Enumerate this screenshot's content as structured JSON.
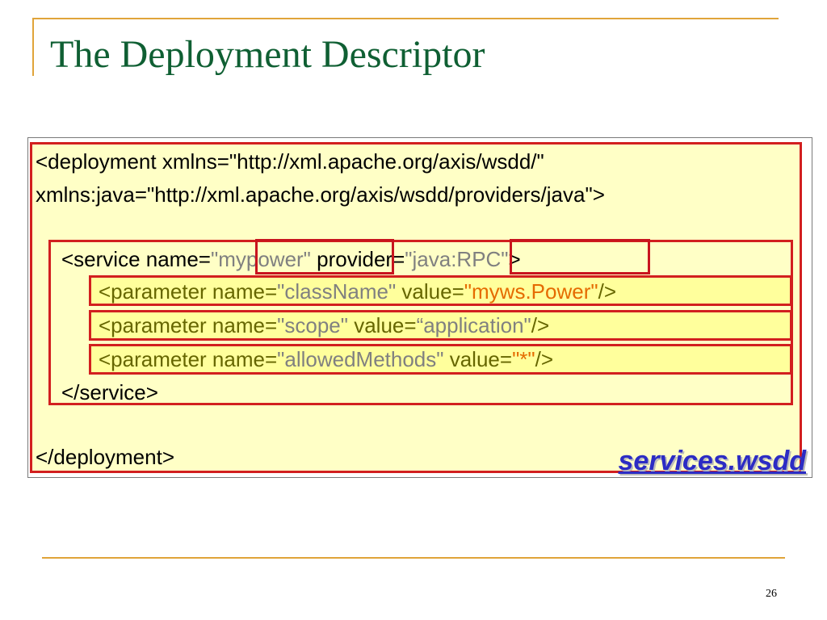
{
  "slide": {
    "title": "The Deployment Descriptor",
    "page_number": "26",
    "file_label": "services.wsdd"
  },
  "code": {
    "deploy_open_1": "<deployment xmlns=\"http://xml.apache.org/axis/wsdd/\"",
    "deploy_open_2": "xmlns:java=\"http://xml.apache.org/axis/wsdd/providers/java\">",
    "service": {
      "tag_start": "<service name=",
      "name_value": "\"mypower\"",
      "provider_attr": " provider=",
      "provider_value": "\"java:RPC\"",
      "tag_end": ">"
    },
    "params": [
      {
        "start": "<parameter name=",
        "name": "\"className\"",
        "value_attr": " value=",
        "value": "\"myws.Power\"",
        "end": "/>"
      },
      {
        "start": "<parameter name=",
        "name": "\"scope\"",
        "value_attr": " value=",
        "value": "“application\"",
        "end": "/>"
      },
      {
        "start": "<parameter name=",
        "name": "\"allowedMethods\"",
        "value_attr": " value=",
        "value": "\"*\"",
        "end": "/>"
      }
    ],
    "service_close": "</service>",
    "deploy_close": "</deployment>"
  },
  "colors": {
    "title": "#0f5f33",
    "accent_rule": "#e0a43a",
    "box_border": "#d21f1f",
    "code_background": "#ffffc6",
    "param_background": "#ffff9c",
    "string_gray": "#808080",
    "value_orange": "#e56b00",
    "label_blue": "#2c2cc4"
  }
}
